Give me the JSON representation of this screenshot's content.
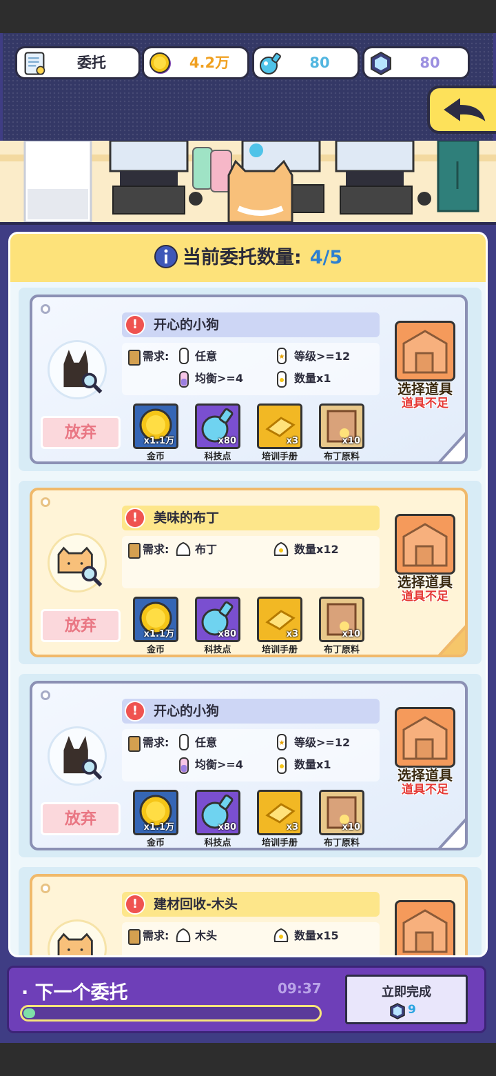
{
  "resources": {
    "commission_label": "委托",
    "gold": "4.2万",
    "tech": "80",
    "gem": "80"
  },
  "header": {
    "count_label": "当前委托数量:",
    "count_value": "4/5"
  },
  "quests": [
    {
      "title": "开心的小狗",
      "style": "blue",
      "avatar": "dog-icon",
      "req_label": "需求:",
      "requirements": [
        "任意",
        "等级>=12",
        "均衡>=4",
        "数量x1"
      ],
      "abandon": "放弃",
      "select": "选择道具",
      "shortage": "道具不足",
      "rewards": [
        {
          "label": "金币",
          "amount": "x1.1万",
          "icon": "gold-coin-icon"
        },
        {
          "label": "科技点",
          "amount": "x80",
          "icon": "tech-potion-icon"
        },
        {
          "label": "培训手册",
          "amount": "x3",
          "icon": "training-manual-icon"
        },
        {
          "label": "布丁原料",
          "amount": "x10",
          "icon": "pudding-material-icon"
        }
      ]
    },
    {
      "title": "美味的布丁",
      "style": "yellow",
      "avatar": "cat-icon",
      "req_label": "需求:",
      "requirements": [
        "布丁",
        "数量x12"
      ],
      "abandon": "放弃",
      "select": "选择道具",
      "shortage": "道具不足",
      "rewards": [
        {
          "label": "金币",
          "amount": "x1.1万",
          "icon": "gold-coin-icon"
        },
        {
          "label": "科技点",
          "amount": "x80",
          "icon": "tech-potion-icon"
        },
        {
          "label": "培训手册",
          "amount": "x3",
          "icon": "training-manual-icon"
        },
        {
          "label": "布丁原料",
          "amount": "x10",
          "icon": "pudding-material-icon"
        }
      ]
    },
    {
      "title": "开心的小狗",
      "style": "blue",
      "avatar": "dog-icon",
      "req_label": "需求:",
      "requirements": [
        "任意",
        "等级>=12",
        "均衡>=4",
        "数量x1"
      ],
      "abandon": "放弃",
      "select": "选择道具",
      "shortage": "道具不足",
      "rewards": [
        {
          "label": "金币",
          "amount": "x1.1万",
          "icon": "gold-coin-icon"
        },
        {
          "label": "科技点",
          "amount": "x80",
          "icon": "tech-potion-icon"
        },
        {
          "label": "培训手册",
          "amount": "x3",
          "icon": "training-manual-icon"
        },
        {
          "label": "布丁原料",
          "amount": "x10",
          "icon": "pudding-material-icon"
        }
      ]
    },
    {
      "title": "建材回收-木头",
      "style": "yellow",
      "avatar": "cat-icon",
      "req_label": "需求:",
      "requirements": [
        "木头",
        "数量x15"
      ]
    }
  ],
  "footer": {
    "next_label": "· 下一个委托",
    "timer": "09:37",
    "progress": 0.04,
    "finish_label": "立即完成",
    "finish_cost": "9"
  },
  "colors": {
    "gold": "#f5c518",
    "tech": "#4fc3e8",
    "gem": "#9b8fe0",
    "warning": "#e53935",
    "accent_blue": "#2c7fd1"
  }
}
